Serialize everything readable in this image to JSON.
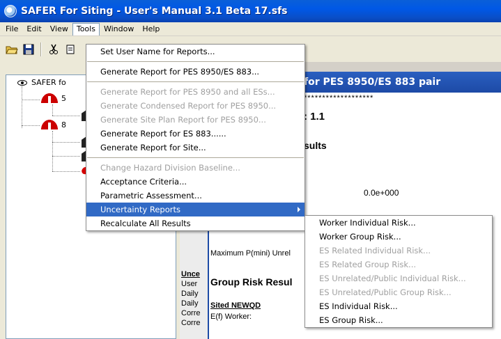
{
  "window": {
    "title": "SAFER For Siting - User's Manual 3.1 Beta 17.sfs"
  },
  "menubar": {
    "items": [
      {
        "label": "File"
      },
      {
        "label": "Edit"
      },
      {
        "label": "View"
      },
      {
        "label": "Tools"
      },
      {
        "label": "Window"
      },
      {
        "label": "Help"
      }
    ]
  },
  "tree": {
    "root_label": "SAFER fo",
    "child1_label": "5",
    "child2_label": "8"
  },
  "report": {
    "header": "for PES 8950/ES 883 pair",
    "stars": "*******************",
    "version": ": 1.1",
    "results": "sults",
    "value1": "0.0e+000",
    "max_pmini": "Maximum P(mini) Unrel",
    "unce": "Unce",
    "user": "User",
    "daily1": "Daily",
    "daily2": "Daily",
    "corre1": "Corre",
    "corre2": "Corre",
    "group_risk": "Group Risk Resul",
    "sited": "Sited NEWQD",
    "ef_worker": "E(f) Worker:"
  },
  "tools_menu": {
    "items": [
      {
        "label": "Set User Name for Reports...",
        "enabled": true
      },
      {
        "label": "Generate Report for PES 8950/ES 883...",
        "enabled": true
      },
      {
        "label": "Generate Report for PES 8950 and all ESs...",
        "enabled": false
      },
      {
        "label": "Generate Condensed Report for PES 8950...",
        "enabled": false
      },
      {
        "label": "Generate Site Plan Report for PES 8950...",
        "enabled": false
      },
      {
        "label": "Generate Report for ES 883......",
        "enabled": true
      },
      {
        "label": "Generate Report for Site...",
        "enabled": true
      },
      {
        "label": "Change Hazard Division Baseline...",
        "enabled": false
      },
      {
        "label": "Acceptance Criteria...",
        "enabled": true
      },
      {
        "label": "Parametric Assessment...",
        "enabled": true
      },
      {
        "label": "Uncertainty Reports",
        "enabled": true
      },
      {
        "label": "Recalculate All Results",
        "enabled": true
      }
    ]
  },
  "uncertainty_menu": {
    "items": [
      {
        "label": "Worker Individual Risk...",
        "enabled": true
      },
      {
        "label": "Worker Group Risk...",
        "enabled": true
      },
      {
        "label": "ES Related Individual Risk...",
        "enabled": false
      },
      {
        "label": "ES Related Group Risk...",
        "enabled": false
      },
      {
        "label": "ES Unrelated/Public Individual Risk...",
        "enabled": false
      },
      {
        "label": "ES Unrelated/Public Group Risk...",
        "enabled": false
      },
      {
        "label": "ES Individual Risk...",
        "enabled": true
      },
      {
        "label": "ES Group Risk...",
        "enabled": true
      }
    ]
  },
  "colors": {
    "title_bar": "#0a5fd8",
    "highlight": "#316ac5",
    "report_header": "#2a5fc0"
  }
}
